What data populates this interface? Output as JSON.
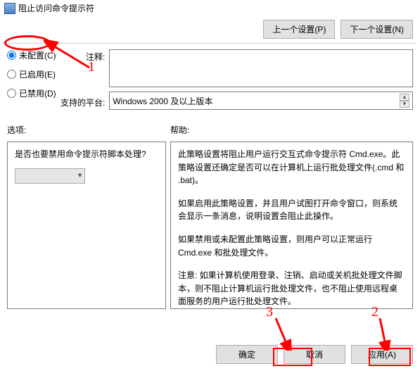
{
  "title": "阻止访问命令提示符",
  "nav": {
    "prev": "上一个设置(P)",
    "next": "下一个设置(N)"
  },
  "radios": {
    "not_configured": "未配置(C)",
    "enabled": "已启用(E)",
    "disabled": "已禁用(D)"
  },
  "labels": {
    "comment": "注释:",
    "platform": "支持的平台:",
    "options": "选项:",
    "help": "帮助:"
  },
  "fields": {
    "comment_value": "",
    "platform_value": "Windows 2000 及以上版本"
  },
  "options": {
    "question": "是否也要禁用命令提示符脚本处理?",
    "combo_value": ""
  },
  "help": {
    "p1": "此策略设置将阻止用户运行交互式命令提示符 Cmd.exe。此策略设置还确定是否可以在计算机上运行批处理文件(.cmd 和 .bat)。",
    "p2": "如果启用此策略设置，并且用户试图打开命令窗口，则系统会显示一条消息，说明设置会阻止此操作。",
    "p3": "如果禁用或未配置此策略设置，则用户可以正常运行 Cmd.exe 和批处理文件。",
    "p4": "注意: 如果计算机使用登录、注销、启动或关机批处理文件脚本，则不阻止计算机运行批处理文件，也不阻止使用远程桌面服务的用户运行批处理文件。"
  },
  "footer": {
    "ok": "确定",
    "cancel": "取消",
    "apply": "应用(A)"
  },
  "annotations": {
    "n1": "1",
    "n2": "2",
    "n3": "3"
  }
}
